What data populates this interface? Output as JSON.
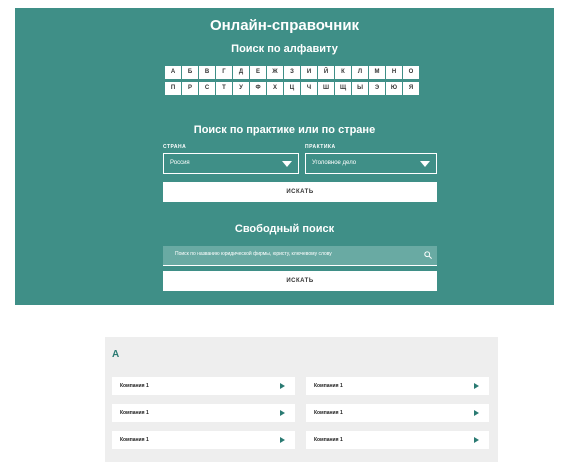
{
  "header": {
    "title": "Онлайн-справочник"
  },
  "alphabet": {
    "title": "Поиск по алфавиту",
    "row1": [
      "А",
      "Б",
      "В",
      "Г",
      "Д",
      "Е",
      "Ж",
      "З",
      "И",
      "Й",
      "К",
      "Л",
      "М",
      "Н",
      "О"
    ],
    "row2": [
      "П",
      "Р",
      "С",
      "Т",
      "У",
      "Ф",
      "Х",
      "Ц",
      "Ч",
      "Ш",
      "Щ",
      "Ы",
      "Э",
      "Ю",
      "Я"
    ]
  },
  "practice": {
    "title": "Поиск по практике или по стране",
    "country_label": "СТРАНА",
    "country_value": "Россия",
    "practice_label": "ПРАКТИКА",
    "practice_value": "Уголовное дело",
    "search_button": "ИСКАТЬ"
  },
  "free": {
    "title": "Свободный поиск",
    "placeholder": "Поиск по названию юридической фирмы, юристу, ключевому слову",
    "search_button": "ИСКАТЬ"
  },
  "results": {
    "letter": "А",
    "items": [
      "Компания 1",
      "Компания 1",
      "Компания 1",
      "Компания 1",
      "Компания 1",
      "Компания 1"
    ]
  },
  "colors": {
    "teal": "#3f8f87",
    "panel": "#eeeeee",
    "arrow": "#2a7a72"
  }
}
